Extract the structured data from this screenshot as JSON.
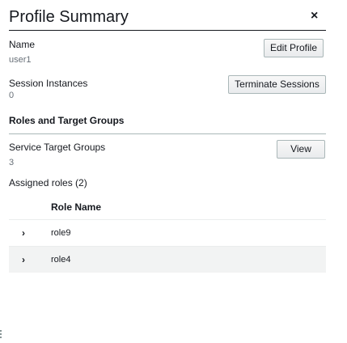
{
  "header": {
    "title": "Profile Summary",
    "close_glyph": "×",
    "close_icon": "close-icon"
  },
  "profile": {
    "name_label": "Name",
    "name_value": "user1",
    "edit_button": "Edit Profile",
    "sessions_label": "Session Instances",
    "sessions_value": "0",
    "terminate_button": "Terminate Sessions"
  },
  "roles_section": {
    "heading": "Roles and Target Groups",
    "stg_label": "Service Target Groups",
    "stg_value": "3",
    "view_button": "View",
    "assigned_label": "Assigned roles (2)",
    "table": {
      "column_header": "Role Name",
      "expand_icon": "chevron-right-icon",
      "expand_glyph": "›",
      "rows": [
        {
          "name": "role9"
        },
        {
          "name": "role4"
        }
      ]
    }
  },
  "colors": {
    "text": "#16191f",
    "muted": "#687078",
    "row_alt": "#f2f3f3",
    "button_border": "#aab7b8"
  }
}
